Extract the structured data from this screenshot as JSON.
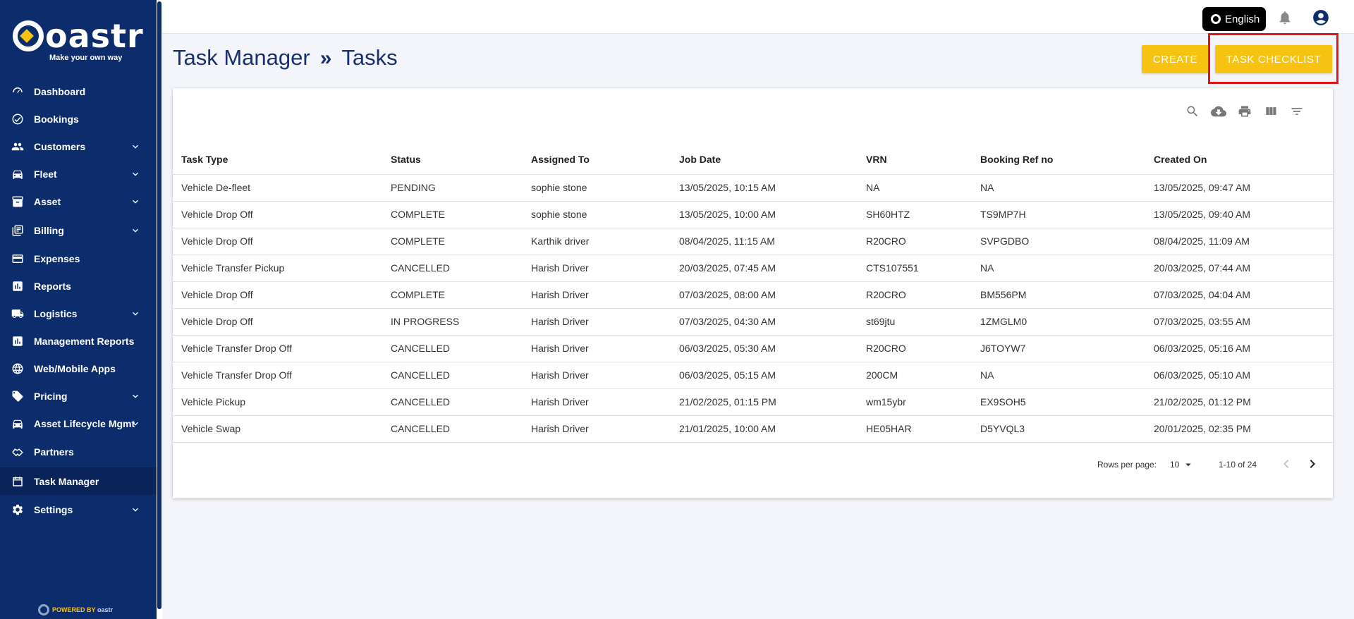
{
  "brand": {
    "name": "oastr",
    "tagline": "Make your own way",
    "powered_by": "POWERED BY",
    "powered_brand": "oastr",
    "accent_color": "#f7c312",
    "sidebar_color": "#0d2c6c"
  },
  "sidebar": {
    "items": [
      {
        "label": "Dashboard",
        "icon": "gauge-icon",
        "has_chevron": false,
        "active": false
      },
      {
        "label": "Bookings",
        "icon": "check-circle-icon",
        "has_chevron": false,
        "active": false
      },
      {
        "label": "Customers",
        "icon": "people-icon",
        "has_chevron": true,
        "active": false
      },
      {
        "label": "Fleet",
        "icon": "car-icon",
        "has_chevron": true,
        "active": false
      },
      {
        "label": "Asset",
        "icon": "archive-icon",
        "has_chevron": true,
        "active": false
      },
      {
        "label": "Billing",
        "icon": "billing-icon",
        "has_chevron": true,
        "active": false
      },
      {
        "label": "Expenses",
        "icon": "credit-card-icon",
        "has_chevron": false,
        "active": false
      },
      {
        "label": "Reports",
        "icon": "bar-chart-icon",
        "has_chevron": false,
        "active": false
      },
      {
        "label": "Logistics",
        "icon": "truck-icon",
        "has_chevron": true,
        "active": false
      },
      {
        "label": "Management Reports",
        "icon": "report-chart-icon",
        "has_chevron": false,
        "active": false
      },
      {
        "label": "Web/Mobile Apps",
        "icon": "globe-icon",
        "has_chevron": false,
        "active": false
      },
      {
        "label": "Pricing",
        "icon": "tag-icon",
        "has_chevron": true,
        "active": false
      },
      {
        "label": "Asset Lifecycle Mgmt",
        "icon": "car-lifecycle-icon",
        "has_chevron": true,
        "active": false
      },
      {
        "label": "Partners",
        "icon": "handshake-icon",
        "has_chevron": false,
        "active": false
      },
      {
        "label": "Task Manager",
        "icon": "calendar-icon",
        "has_chevron": false,
        "active": true
      },
      {
        "label": "Settings",
        "icon": "gear-icon",
        "has_chevron": true,
        "active": false
      }
    ]
  },
  "header": {
    "language": "English"
  },
  "page": {
    "breadcrumb_parent": "Task Manager",
    "breadcrumb_sep": "»",
    "breadcrumb_current": "Tasks",
    "create_label": "CREATE",
    "checklist_label": "TASK CHECKLIST"
  },
  "table": {
    "columns": [
      "Task Type",
      "Status",
      "Assigned To",
      "Job Date",
      "VRN",
      "Booking Ref no",
      "Created On"
    ],
    "rows": [
      [
        "Vehicle De-fleet",
        "PENDING",
        "sophie stone",
        "13/05/2025, 10:15 AM",
        "NA",
        "NA",
        "13/05/2025, 09:47 AM"
      ],
      [
        "Vehicle Drop Off",
        "COMPLETE",
        "sophie stone",
        "13/05/2025, 10:00 AM",
        "SH60HTZ",
        "TS9MP7H",
        "13/05/2025, 09:40 AM"
      ],
      [
        "Vehicle Drop Off",
        "COMPLETE",
        "Karthik driver",
        "08/04/2025, 11:15 AM",
        "R20CRO",
        "SVPGDBO",
        "08/04/2025, 11:09 AM"
      ],
      [
        "Vehicle Transfer Pickup",
        "CANCELLED",
        "Harish Driver",
        "20/03/2025, 07:45 AM",
        "CTS107551",
        "NA",
        "20/03/2025, 07:44 AM"
      ],
      [
        "Vehicle Drop Off",
        "COMPLETE",
        "Harish Driver",
        "07/03/2025, 08:00 AM",
        "R20CRO",
        "BM556PM",
        "07/03/2025, 04:04 AM"
      ],
      [
        "Vehicle Drop Off",
        "IN PROGRESS",
        "Harish Driver",
        "07/03/2025, 04:30 AM",
        "st69jtu",
        "1ZMGLM0",
        "07/03/2025, 03:55 AM"
      ],
      [
        "Vehicle Transfer Drop Off",
        "CANCELLED",
        "Harish Driver",
        "06/03/2025, 05:30 AM",
        "R20CRO",
        "J6TOYW7",
        "06/03/2025, 05:16 AM"
      ],
      [
        "Vehicle Transfer Drop Off",
        "CANCELLED",
        "Harish Driver",
        "06/03/2025, 05:15 AM",
        "200CM",
        "NA",
        "06/03/2025, 05:10 AM"
      ],
      [
        "Vehicle Pickup",
        "CANCELLED",
        "Harish Driver",
        "21/02/2025, 01:15 PM",
        "wm15ybr",
        "EX9SOH5",
        "21/02/2025, 01:12 PM"
      ],
      [
        "Vehicle Swap",
        "CANCELLED",
        "Harish Driver",
        "21/01/2025, 10:00 AM",
        "HE05HAR",
        "D5YVQL3",
        "20/01/2025, 02:35 PM"
      ]
    ]
  },
  "pagination": {
    "rows_per_page_label": "Rows per page:",
    "rows_per_page": "10",
    "range": "1-10 of 24"
  }
}
